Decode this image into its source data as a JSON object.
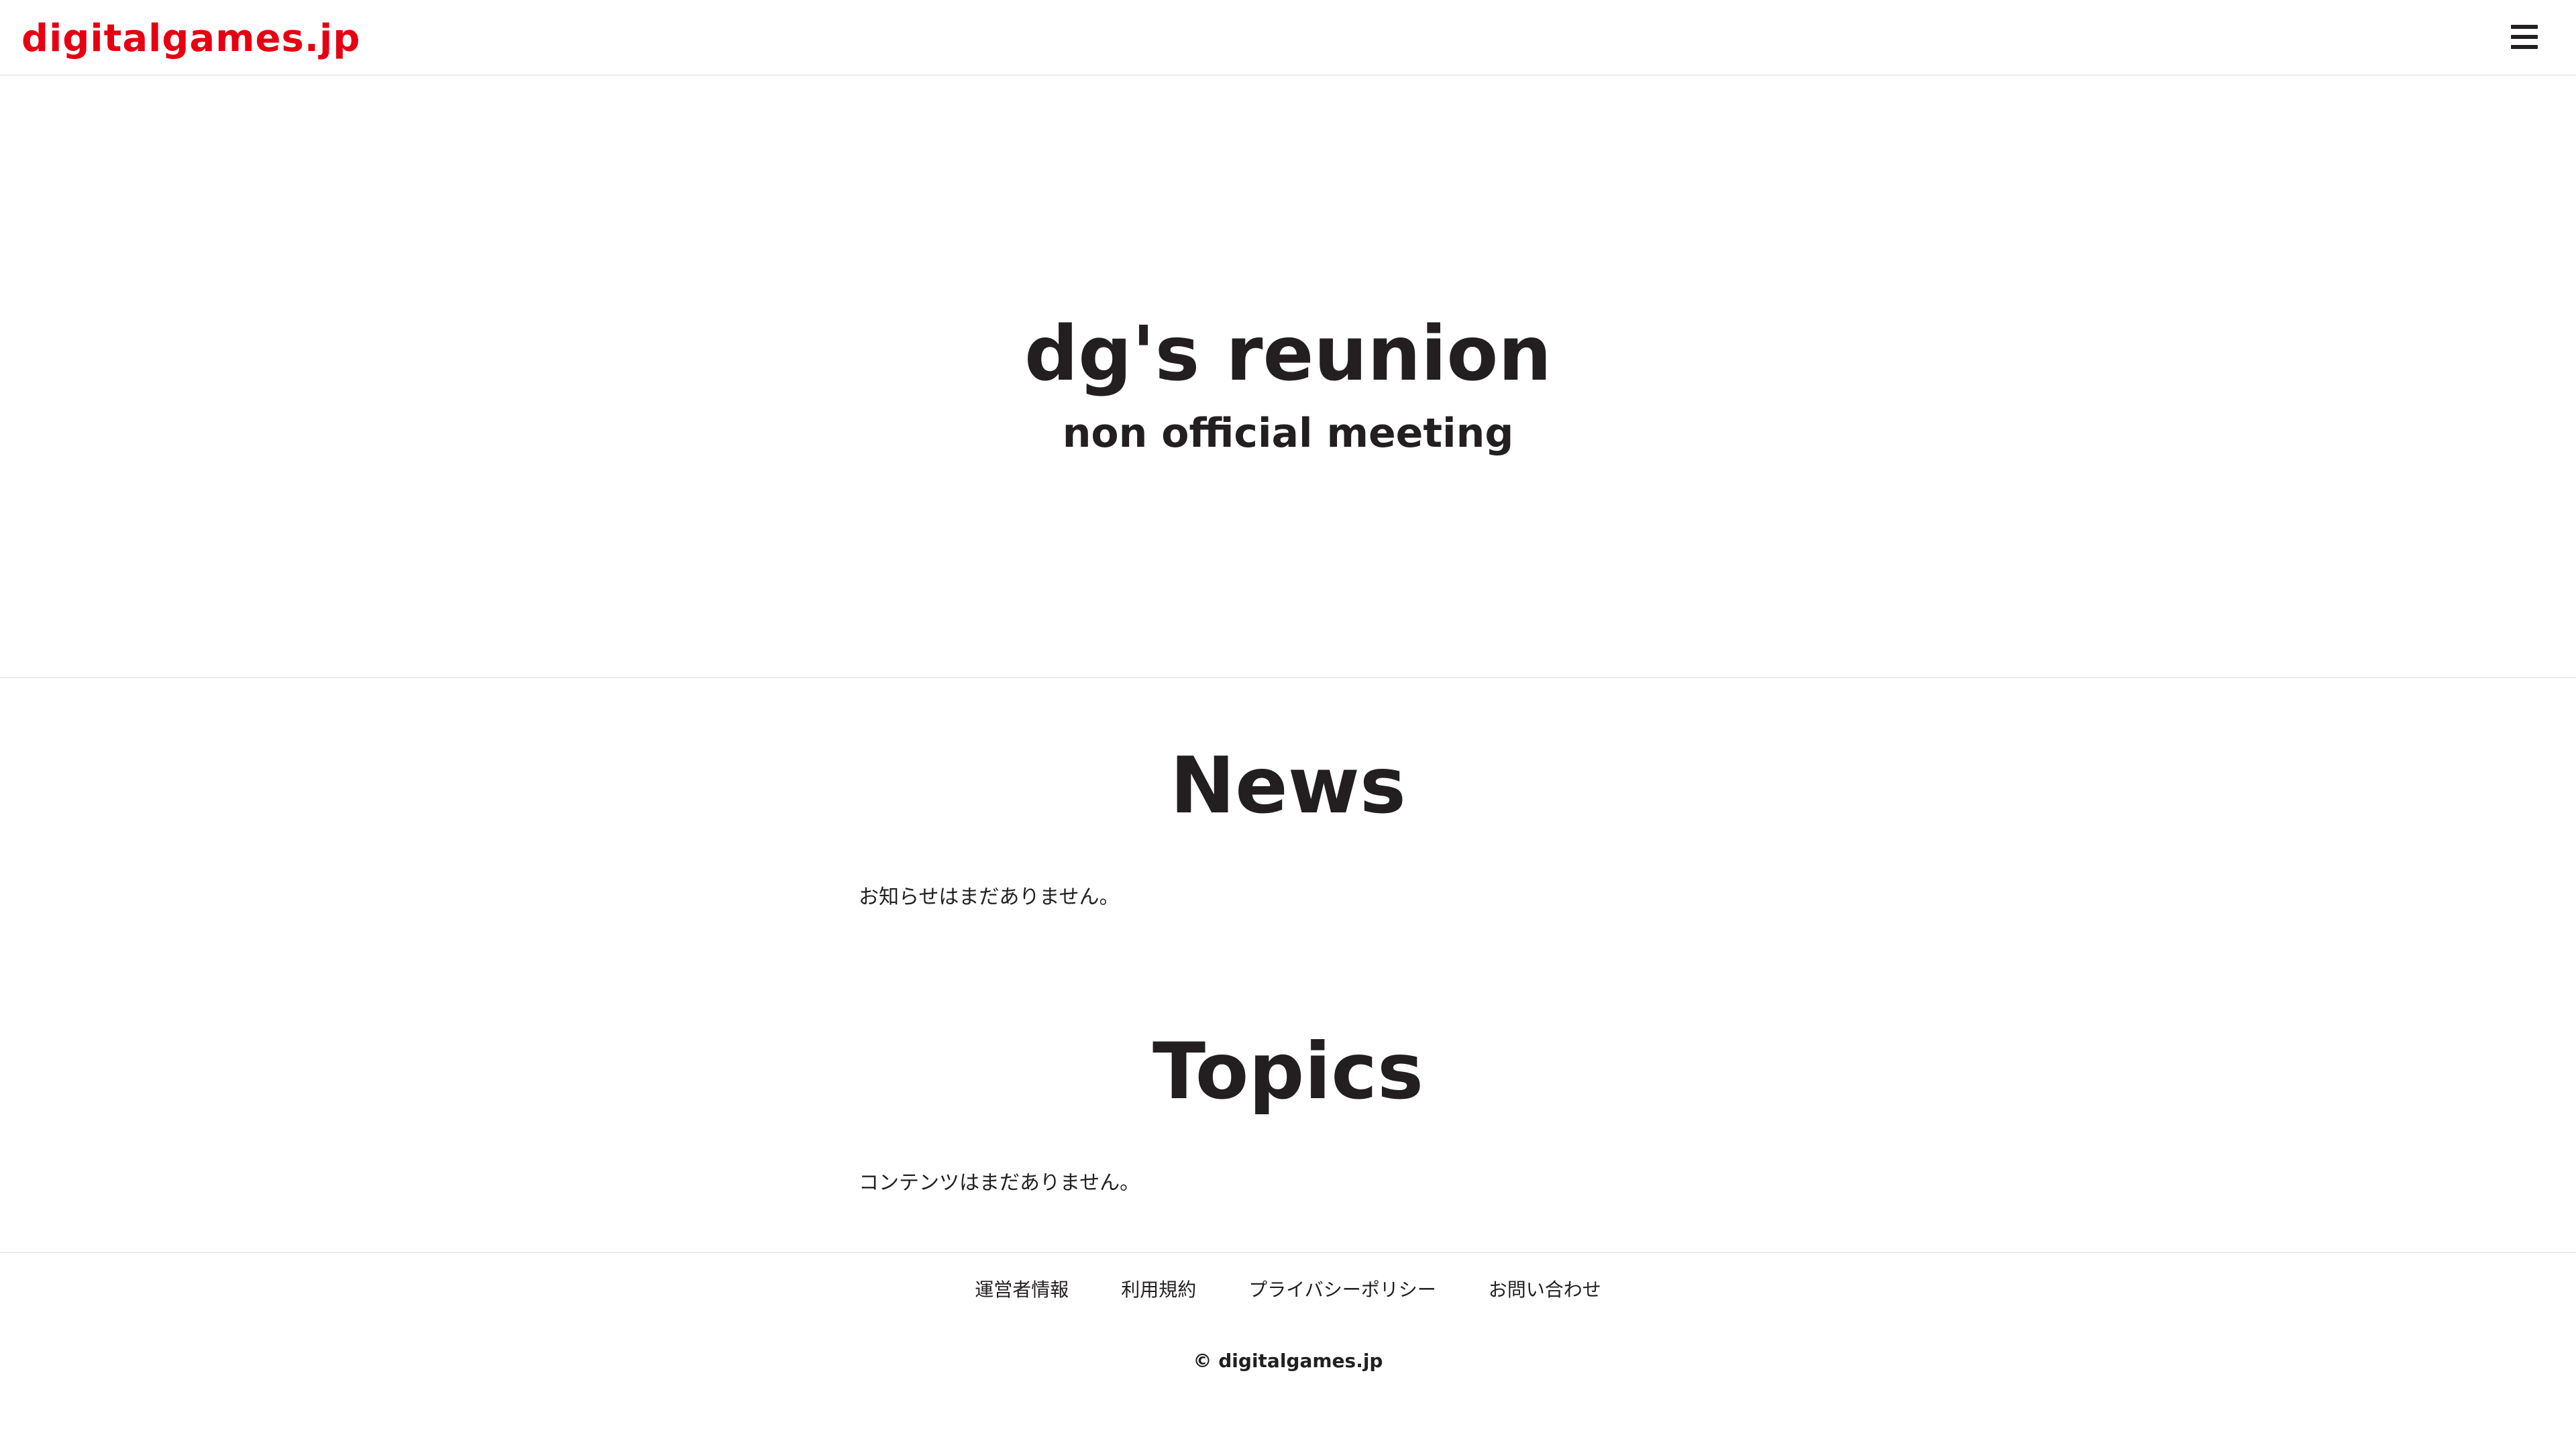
{
  "header": {
    "logo": "digitalgames.jp",
    "menu_icon": "hamburger-menu-icon"
  },
  "hero": {
    "title": "dg's reunion",
    "subtitle": "non official meeting"
  },
  "news": {
    "heading": "News",
    "empty_message": "お知らせはまだありません。"
  },
  "topics": {
    "heading": "Topics",
    "empty_message": "コンテンツはまだありません。"
  },
  "footer": {
    "links": [
      {
        "label": "運営者情報"
      },
      {
        "label": "利用規約"
      },
      {
        "label": "プライバシーポリシー"
      },
      {
        "label": "お問い合わせ"
      }
    ],
    "copyright": "© digitalgames.jp"
  },
  "colors": {
    "brand": "#e60012",
    "text": "#231f20",
    "divider": "#ececec",
    "background": "#ffffff"
  }
}
